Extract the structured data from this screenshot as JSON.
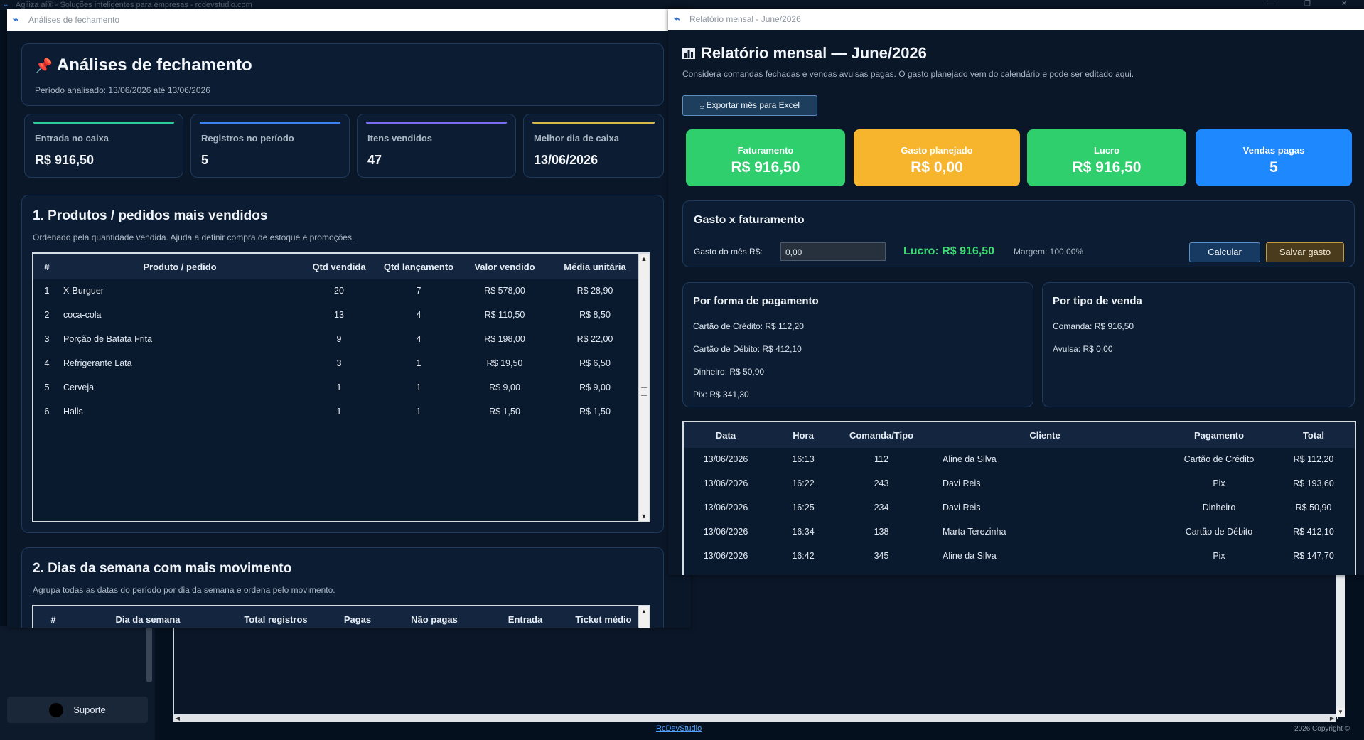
{
  "background_app": {
    "title": "Agiliza aí® - Soluções inteligentes para empresas - rcdevstudio.com",
    "support_label": "Suporte",
    "footer_link": "RcDevStudio",
    "footer_copyright": "2026 Copyright ©"
  },
  "analises": {
    "window_title": "Análises de fechamento",
    "heading": "Análises de fechamento",
    "period": "Período analisado: 13/06/2026 até 13/06/2026",
    "kpis": [
      {
        "label": "Entrada no caixa",
        "value": "R$ 916,50",
        "color": "#2ecc9a"
      },
      {
        "label": "Registros no período",
        "value": "5",
        "color": "#3b82f6"
      },
      {
        "label": "Itens vendidos",
        "value": "47",
        "color": "#7b6cf6"
      },
      {
        "label": "Melhor dia de caixa",
        "value": "13/06/2026",
        "color": "#d8b84a"
      }
    ],
    "section1": {
      "title": "1. Produtos / pedidos mais vendidos",
      "description": "Ordenado pela quantidade vendida. Ajuda a definir compra de estoque e promoções.",
      "columns": [
        "#",
        "Produto / pedido",
        "Qtd vendida",
        "Qtd lançamento",
        "Valor vendido",
        "Média unitária"
      ],
      "rows": [
        [
          "1",
          "X-Burguer",
          "20",
          "7",
          "R$ 578,00",
          "R$ 28,90"
        ],
        [
          "2",
          "coca-cola",
          "13",
          "4",
          "R$ 110,50",
          "R$ 8,50"
        ],
        [
          "3",
          "Porção de Batata Frita",
          "9",
          "4",
          "R$ 198,00",
          "R$ 22,00"
        ],
        [
          "4",
          "Refrigerante Lata",
          "3",
          "1",
          "R$ 19,50",
          "R$ 6,50"
        ],
        [
          "5",
          "Cerveja",
          "1",
          "1",
          "R$ 9,00",
          "R$ 9,00"
        ],
        [
          "6",
          "Halls",
          "1",
          "1",
          "R$ 1,50",
          "R$ 1,50"
        ]
      ]
    },
    "section2": {
      "title": "2. Dias da semana com mais movimento",
      "description": "Agrupa todas as datas do período por dia da semana e ordena pelo movimento.",
      "columns": [
        "#",
        "Dia da semana",
        "Total registros",
        "Pagas",
        "Não pagas",
        "Entrada",
        "Ticket médio"
      ]
    }
  },
  "relatorio": {
    "window_title": "Relatório mensal - June/2026",
    "heading": "Relatório mensal — June/2026",
    "description": "Considera comandas fechadas e vendas avulsas pagas. O gasto planejado vem do calendário e pode ser editado aqui.",
    "export_button": "Exportar mês para Excel",
    "cards": [
      {
        "label": "Faturamento",
        "value": "R$ 916,50",
        "color": "#2fcf6e"
      },
      {
        "label": "Gasto planejado",
        "value": "R$ 0,00",
        "color": "#f7b52e"
      },
      {
        "label": "Lucro",
        "value": "R$ 916,50",
        "color": "#2fcf6e"
      },
      {
        "label": "Vendas pagas",
        "value": "5",
        "color": "#1e88ff"
      }
    ],
    "gasto": {
      "title": "Gasto x faturamento",
      "input_label": "Gasto do mês R$:",
      "input_value": "0,00",
      "lucro": "Lucro: R$ 916,50",
      "margem": "Margem: 100,00%",
      "calc_button": "Calcular",
      "save_button": "Salvar gasto"
    },
    "pagamento": {
      "title": "Por forma de pagamento",
      "lines": [
        "Cartão de Crédito: R$ 112,20",
        "Cartão de Débito: R$ 412,10",
        "Dinheiro: R$ 50,90",
        "Pix: R$ 341,30"
      ]
    },
    "tipo": {
      "title": "Por tipo de venda",
      "lines": [
        "Comanda: R$ 916,50",
        "Avulsa: R$ 0,00"
      ]
    },
    "table": {
      "columns": [
        "Data",
        "Hora",
        "Comanda/Tipo",
        "Cliente",
        "Pagamento",
        "Total"
      ],
      "rows": [
        [
          "13/06/2026",
          "16:13",
          "112",
          "Aline da Silva",
          "Cartão de Crédito",
          "R$ 112,20"
        ],
        [
          "13/06/2026",
          "16:22",
          "243",
          "Davi Reis",
          "Pix",
          "R$ 193,60"
        ],
        [
          "13/06/2026",
          "16:25",
          "234",
          "Davi Reis",
          "Dinheiro",
          "R$ 50,90"
        ],
        [
          "13/06/2026",
          "16:34",
          "138",
          "Marta Terezinha",
          "Cartão de Débito",
          "R$ 412,10"
        ],
        [
          "13/06/2026",
          "16:42",
          "345",
          "Aline da Silva",
          "Pix",
          "R$ 147,70"
        ]
      ]
    }
  }
}
